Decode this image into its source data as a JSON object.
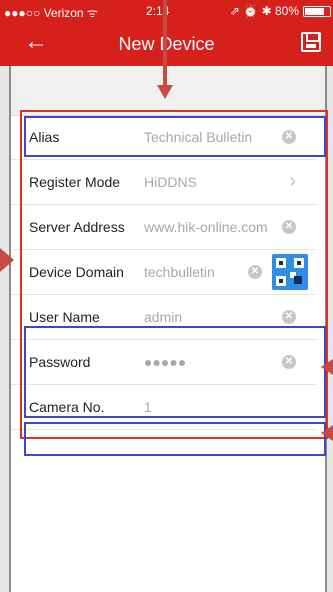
{
  "status_bar": {
    "carrier": "●●●○○ Verizon ᯤ",
    "time": "2:14",
    "right": "⇗ ⏰ ✱ 80%",
    "battery_level": 0.8
  },
  "nav": {
    "back_icon": "arrow-left-icon",
    "title": "New Device",
    "save_icon": "save-icon"
  },
  "form": {
    "alias": {
      "label": "Alias",
      "value": "Technical Bulletin",
      "action": "clear-icon"
    },
    "register_mode": {
      "label": "Register Mode",
      "value": "HiDDNS",
      "action": "chevron-right-icon"
    },
    "server_address": {
      "label": "Server Address",
      "value": "www.hik-online.com",
      "action": "clear-icon"
    },
    "device_domain": {
      "label": "Device Domain",
      "value": "techbulletin",
      "action": "clear-icon",
      "extra_icon": "qr-code-icon"
    },
    "user_name": {
      "label": "User Name",
      "value": "admin",
      "action": "clear-icon"
    },
    "password": {
      "label": "Password",
      "value": "●●●●●",
      "action": "clear-icon"
    },
    "camera_no": {
      "label": "Camera No.",
      "value": "1"
    }
  },
  "colors": {
    "brand_red": "#d6201c",
    "highlight_red": "#d9332b",
    "highlight_blue": "#3c47c9",
    "qr_blue": "#2f8ee3"
  }
}
